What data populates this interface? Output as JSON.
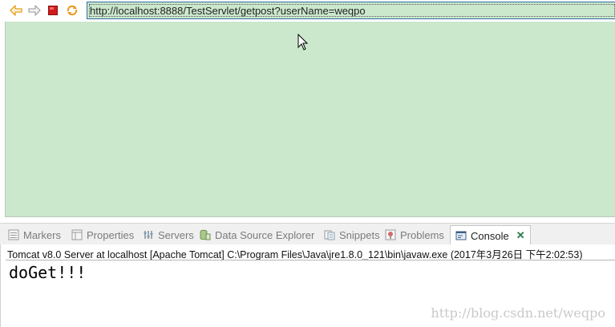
{
  "browser": {
    "url": "http://localhost:8888/TestServlet/getpost?userName=weqpo"
  },
  "tabs": [
    {
      "label": "Markers",
      "icon": "markers-icon"
    },
    {
      "label": "Properties",
      "icon": "properties-icon"
    },
    {
      "label": "Servers",
      "icon": "servers-icon"
    },
    {
      "label": "Data Source Explorer",
      "icon": "data-source-icon"
    },
    {
      "label": "Snippets",
      "icon": "snippets-icon"
    },
    {
      "label": "Problems",
      "icon": "problems-icon"
    },
    {
      "label": "Console",
      "icon": "console-icon",
      "active": true
    }
  ],
  "console": {
    "description": "Tomcat v8.0 Server at localhost [Apache Tomcat] C:\\Program Files\\Java\\jre1.8.0_121\\bin\\javaw.exe (2017年3月26日 下午2:02:53)",
    "output": "doGet!!!",
    "watermark": "http://blog.csdn.net/weqpo"
  },
  "colors": {
    "browser_bg": "#cbe8cd",
    "url_border": "#2f6f9f",
    "stop_red": "#d11b1b",
    "nav_orange": "#e89a1c"
  }
}
